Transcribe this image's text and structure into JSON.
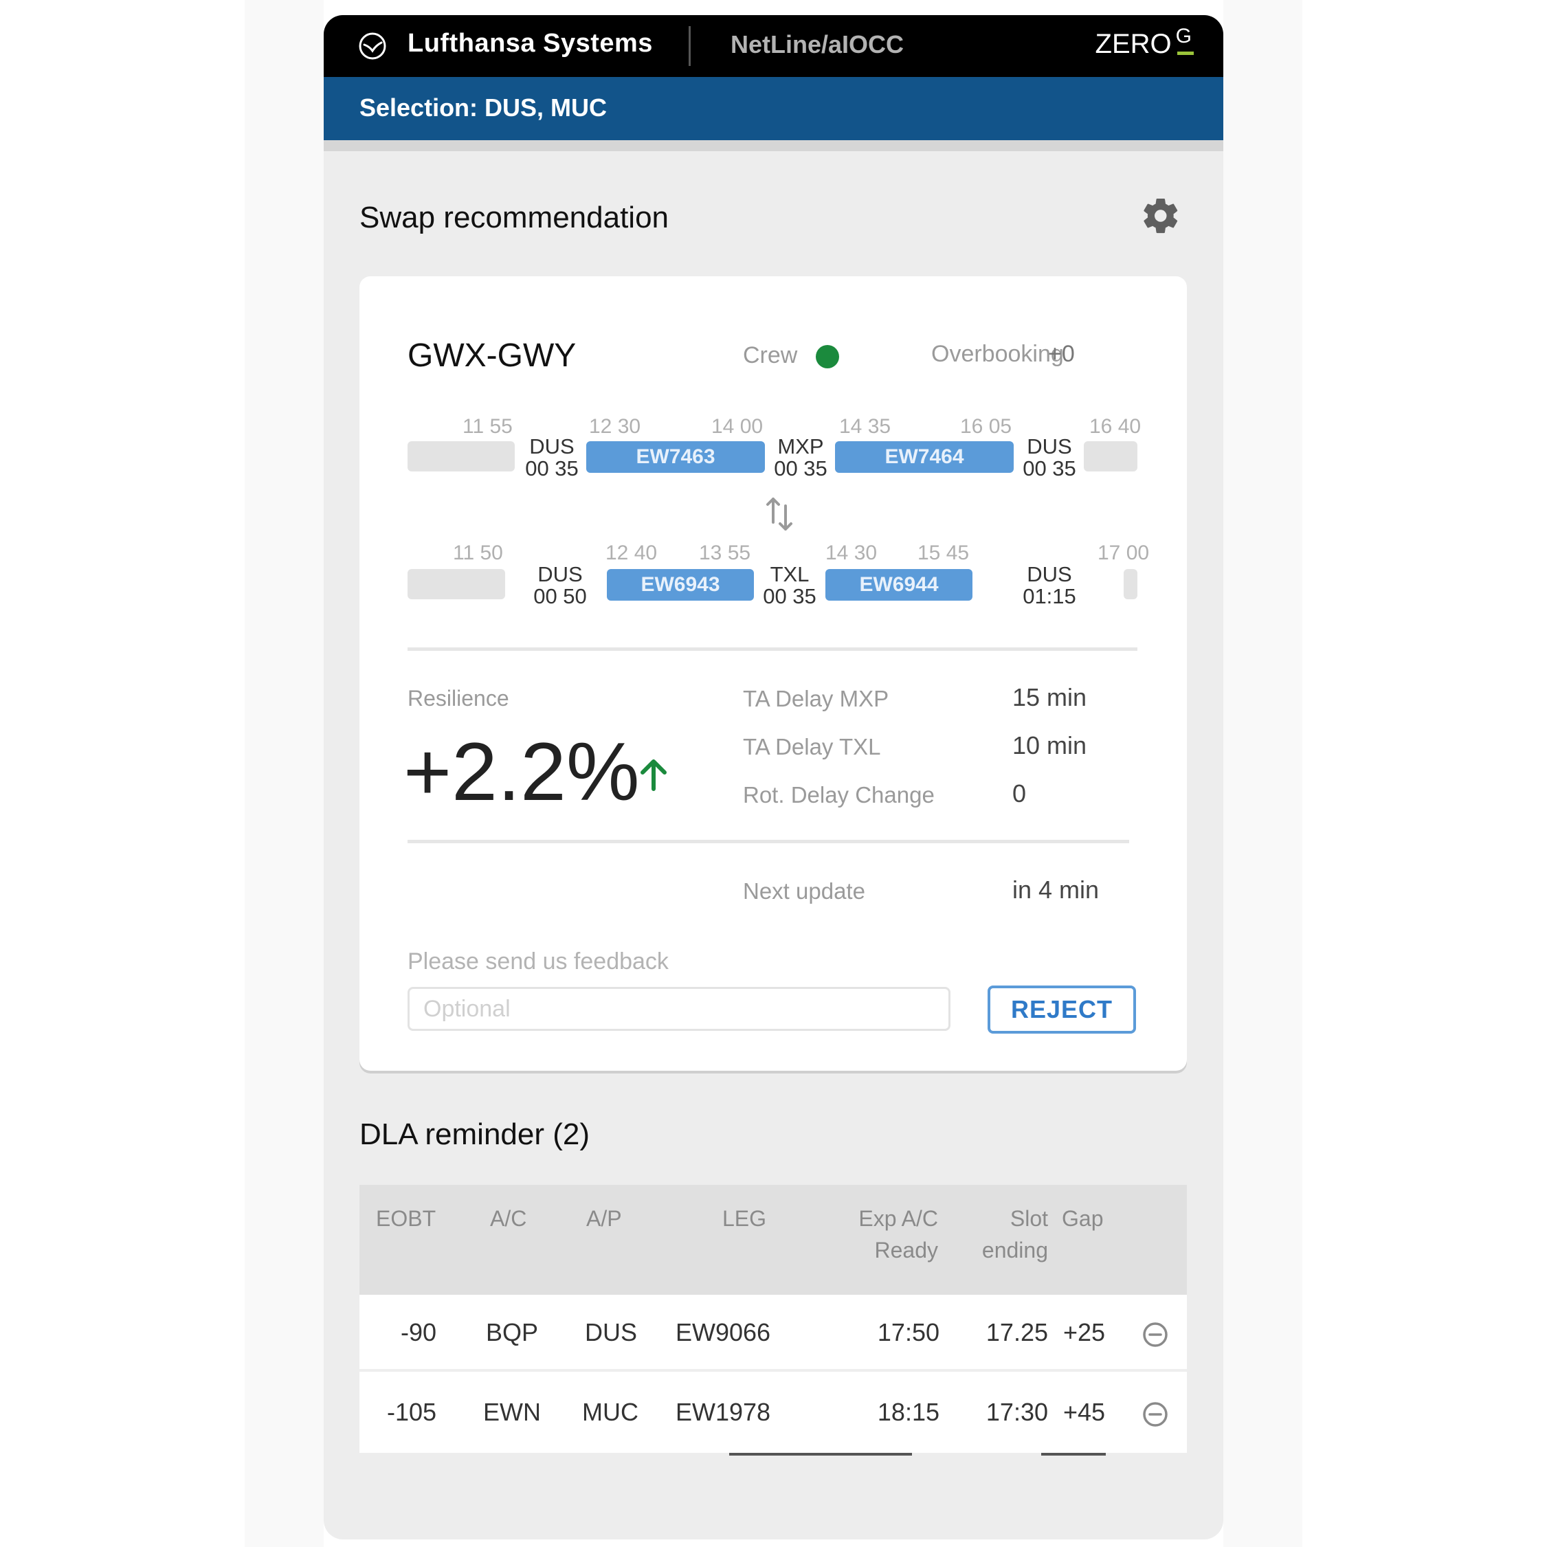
{
  "header": {
    "brand": "Lufthansa Systems",
    "product": "NetLine/aIOCC",
    "zero": "ZERO",
    "zero_mark": "G"
  },
  "selection_bar": {
    "text": "Selection: DUS, MUC"
  },
  "swap": {
    "title": "Swap recommendation",
    "settings_icon": "gear-icon",
    "tail": "GWX-GWY",
    "crew_label": "Crew",
    "crew_status_color": "#1b8a3d",
    "overbooking_label": "Overbooking",
    "overbooking_value": "+0",
    "rotation_top": {
      "times": [
        "11 55",
        "12 30",
        "14 00",
        "14 35",
        "16 05",
        "16 40"
      ],
      "airports": [
        {
          "code": "DUS",
          "ground": "00 35"
        },
        {
          "code": "MXP",
          "ground": "00 35"
        },
        {
          "code": "DUS",
          "ground": "00 35"
        }
      ],
      "flights": [
        "EW7463",
        "EW7464"
      ]
    },
    "swap_icon": "swap-vertical-icon",
    "rotation_bottom": {
      "times": [
        "11 50",
        "12 40",
        "13 55",
        "14 30",
        "15 45",
        "17 00"
      ],
      "airports": [
        {
          "code": "DUS",
          "ground": "00 50"
        },
        {
          "code": "TXL",
          "ground": "00 35"
        },
        {
          "code": "DUS",
          "ground": "01:15"
        }
      ],
      "flights": [
        "EW6943",
        "EW6944"
      ]
    },
    "resilience_label": "Resilience",
    "resilience_value": "+2.2%",
    "resilience_trend_color": "#1b8a3d",
    "metrics": [
      {
        "label": "TA Delay MXP",
        "value": "15 min"
      },
      {
        "label": "TA Delay TXL",
        "value": "10 min"
      },
      {
        "label": "Rot. Delay Change",
        "value": "0"
      }
    ],
    "next_update_label": "Next update",
    "next_update_value": "in 4 min",
    "feedback_label": "Please send us feedback",
    "feedback_placeholder": "Optional",
    "reject_label": "REJECT"
  },
  "dla": {
    "title": "DLA reminder (2)",
    "columns": [
      "EOBT",
      "A/C",
      "A/P",
      "LEG",
      "Exp A/C\nReady",
      "Slot\nending",
      "Gap"
    ],
    "columns_display": {
      "eobt": "EOBT",
      "ac": "A/C",
      "ap": "A/P",
      "leg": "LEG",
      "exp_line1": "Exp  A/C",
      "exp_line2": "Ready",
      "slot_line1": "Slot",
      "slot_line2": "ending",
      "gap": "Gap"
    },
    "rows": [
      {
        "eobt": "-90",
        "ac": "BQP",
        "ap": "DUS",
        "leg": "EW9066",
        "exp": "17:50",
        "slot": "17.25",
        "gap": "+25",
        "icon": "remove-circle-icon"
      },
      {
        "eobt": "-105",
        "ac": "EWN",
        "ap": "MUC",
        "leg": "EW1978",
        "exp": "18:15",
        "slot": "17:30",
        "gap": "+45",
        "icon": "remove-circle-icon"
      }
    ]
  }
}
